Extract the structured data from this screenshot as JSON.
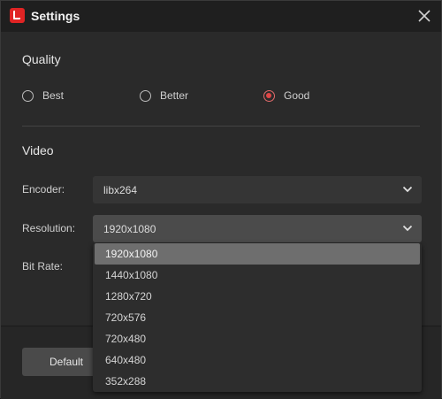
{
  "window": {
    "title": "Settings"
  },
  "quality": {
    "heading": "Quality",
    "options": [
      {
        "label": "Best",
        "checked": false
      },
      {
        "label": "Better",
        "checked": false
      },
      {
        "label": "Good",
        "checked": true
      }
    ]
  },
  "video": {
    "heading": "Video",
    "encoder": {
      "label": "Encoder:",
      "value": "libx264"
    },
    "resolution": {
      "label": "Resolution:",
      "value": "1920x1080",
      "options": [
        "1920x1080",
        "1440x1080",
        "1280x720",
        "720x576",
        "720x480",
        "640x480",
        "352x288"
      ],
      "selected_index": 0
    },
    "bitrate": {
      "label": "Bit Rate:"
    }
  },
  "footer": {
    "default_label": "Default"
  },
  "colors": {
    "accent": "#e04646",
    "brand": "#e02424"
  }
}
